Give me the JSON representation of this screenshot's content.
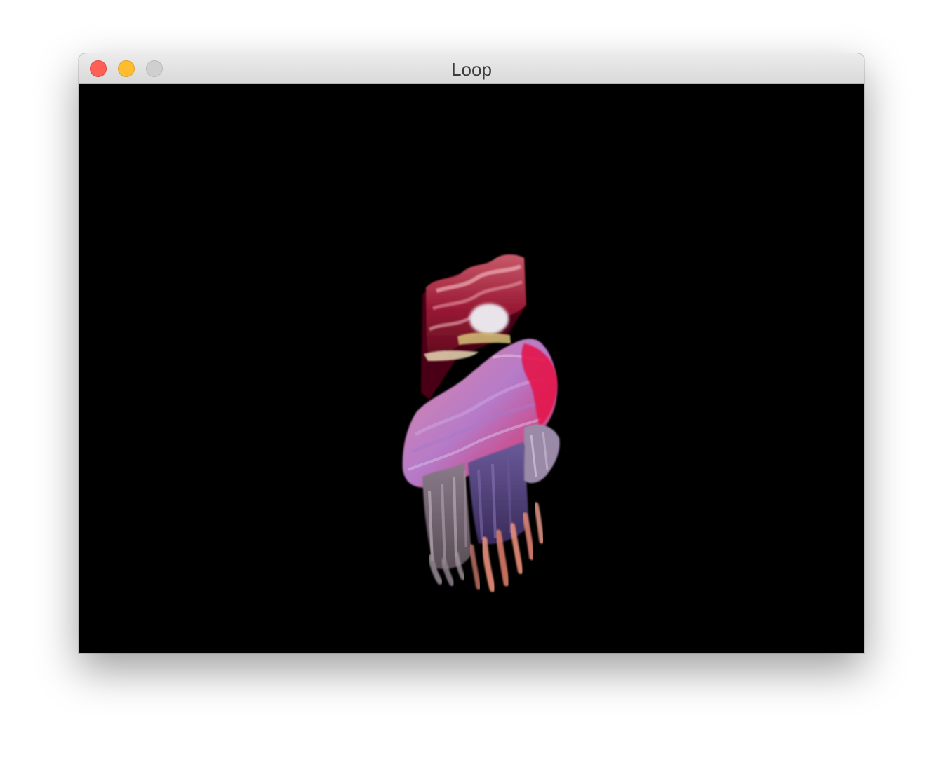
{
  "window": {
    "title": "Loop",
    "controls": {
      "close": "close-icon",
      "minimize": "minimize-icon",
      "zoom": "zoom-icon"
    },
    "colors": {
      "close": "#fe5f57",
      "minimize": "#febc2e",
      "zoom_disabled": "#cfcfcf",
      "content_background": "#000000"
    }
  },
  "content": {
    "artwork": "glitch-artwork-image"
  }
}
